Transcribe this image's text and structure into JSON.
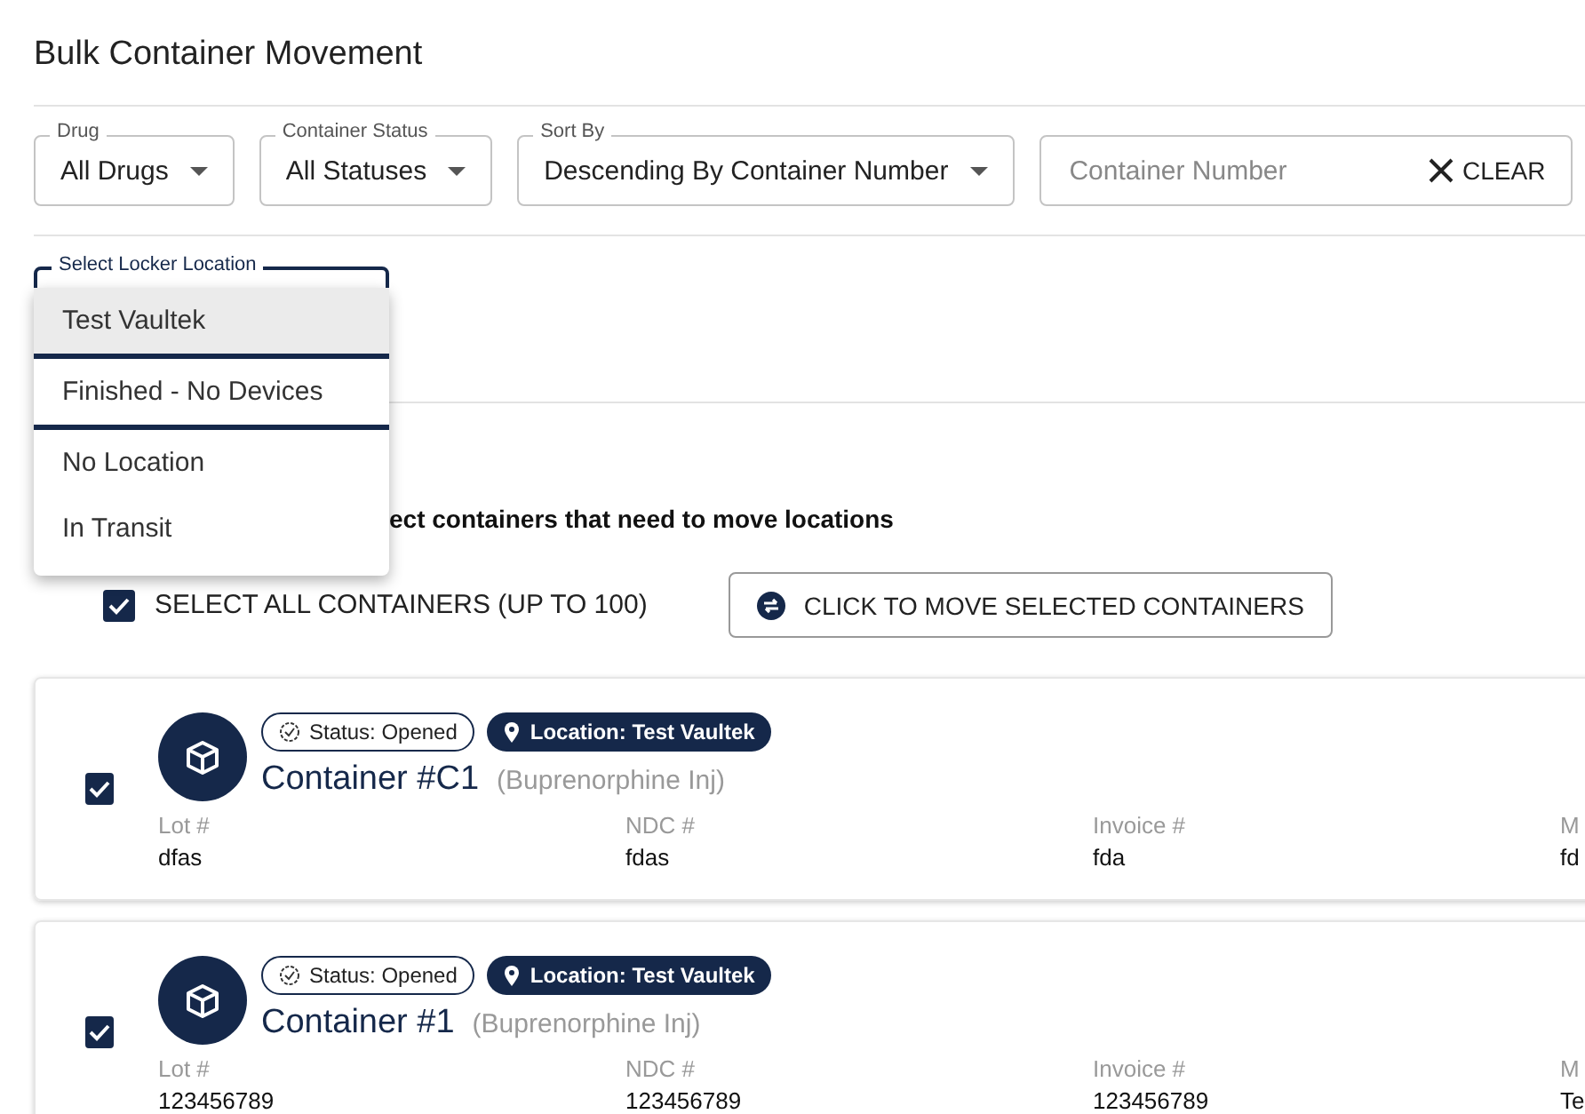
{
  "page_title": "Bulk Container Movement",
  "filters": [
    {
      "label": "Drug",
      "value": "All Drugs"
    },
    {
      "label": "Container Status",
      "value": "All Statuses"
    },
    {
      "label": "Sort By",
      "value": "Descending By Container Number"
    }
  ],
  "search": {
    "placeholder": "Container Number",
    "clear_label": "CLEAR"
  },
  "locker_select": {
    "label": "Select Locker Location",
    "expanded": true,
    "options": [
      {
        "label": "Test Vaultek",
        "selected": true,
        "divider_after": true
      },
      {
        "label": "Finished - No Devices",
        "selected": false,
        "divider_after": true
      },
      {
        "label": "No Location",
        "selected": false,
        "divider_after": false
      },
      {
        "label": "In Transit",
        "selected": false,
        "divider_after": false
      }
    ]
  },
  "instruction": "ect containers that need to move locations",
  "select_all": {
    "label": "SELECT ALL CONTAINERS (UP TO 100)",
    "checked": true
  },
  "move_button": "CLICK TO MOVE SELECTED CONTAINERS",
  "containers": [
    {
      "checked": true,
      "status": "Status: Opened",
      "location": "Location: Test Vaultek",
      "name": "Container #C1",
      "drug": "(Buprenorphine Inj)",
      "fields": [
        {
          "label": "Lot #",
          "value": "dfas"
        },
        {
          "label": "NDC #",
          "value": "fdas"
        },
        {
          "label": "Invoice #",
          "value": "fda"
        },
        {
          "label": "M",
          "value": "fd"
        }
      ]
    },
    {
      "checked": true,
      "status": "Status: Opened",
      "location": "Location: Test Vaultek",
      "name": "Container #1",
      "drug": "(Buprenorphine Inj)",
      "fields": [
        {
          "label": "Lot #",
          "value": "123456789"
        },
        {
          "label": "NDC #",
          "value": "123456789"
        },
        {
          "label": "Invoice #",
          "value": "123456789"
        },
        {
          "label": "M",
          "value": "Te"
        }
      ]
    }
  ]
}
